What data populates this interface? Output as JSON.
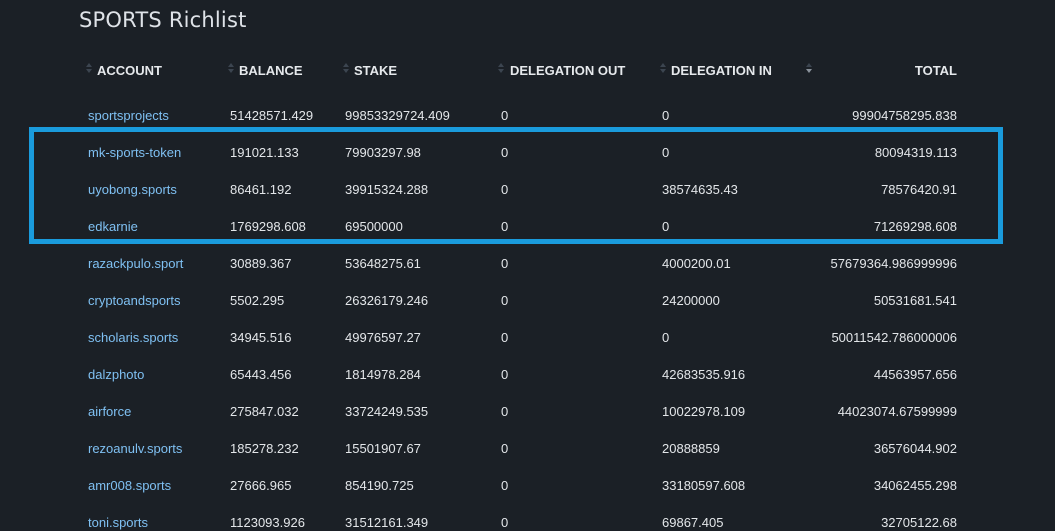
{
  "page_title": "SPORTS Richlist",
  "columns": {
    "account": "ACCOUNT",
    "balance": "BALANCE",
    "stake": "STAKE",
    "delegation_out": "DELEGATION OUT",
    "delegation_in": "DELEGATION IN",
    "total": "TOTAL"
  },
  "rows": [
    {
      "account": "sportsprojects",
      "balance": "51428571.429",
      "stake": "99853329724.409",
      "delegation_out": "0",
      "delegation_in": "0",
      "total": "99904758295.838"
    },
    {
      "account": "mk-sports-token",
      "balance": "191021.133",
      "stake": "79903297.98",
      "delegation_out": "0",
      "delegation_in": "0",
      "total": "80094319.113"
    },
    {
      "account": "uyobong.sports",
      "balance": "86461.192",
      "stake": "39915324.288",
      "delegation_out": "0",
      "delegation_in": "38574635.43",
      "total": "78576420.91"
    },
    {
      "account": "edkarnie",
      "balance": "1769298.608",
      "stake": "69500000",
      "delegation_out": "0",
      "delegation_in": "0",
      "total": "71269298.608"
    },
    {
      "account": "razackpulo.sport",
      "balance": "30889.367",
      "stake": "53648275.61",
      "delegation_out": "0",
      "delegation_in": "4000200.01",
      "total": "57679364.986999996"
    },
    {
      "account": "cryptoandsports",
      "balance": "5502.295",
      "stake": "26326179.246",
      "delegation_out": "0",
      "delegation_in": "24200000",
      "total": "50531681.541"
    },
    {
      "account": "scholaris.sports",
      "balance": "34945.516",
      "stake": "49976597.27",
      "delegation_out": "0",
      "delegation_in": "0",
      "total": "50011542.786000006"
    },
    {
      "account": "dalzphoto",
      "balance": "65443.456",
      "stake": "1814978.284",
      "delegation_out": "0",
      "delegation_in": "42683535.916",
      "total": "44563957.656"
    },
    {
      "account": "airforce",
      "balance": "275847.032",
      "stake": "33724249.535",
      "delegation_out": "0",
      "delegation_in": "10022978.109",
      "total": "44023074.67599999"
    },
    {
      "account": "rezoanulv.sports",
      "balance": "185278.232",
      "stake": "15501907.67",
      "delegation_out": "0",
      "delegation_in": "20888859",
      "total": "36576044.902"
    },
    {
      "account": "amr008.sports",
      "balance": "27666.965",
      "stake": "854190.725",
      "delegation_out": "0",
      "delegation_in": "33180597.608",
      "total": "34062455.298"
    },
    {
      "account": "toni.sports",
      "balance": "1123093.926",
      "stake": "31512161.349",
      "delegation_out": "0",
      "delegation_in": "69867.405",
      "total": "32705122.68"
    }
  ],
  "highlight_color": "#1a9bdc",
  "link_color": "#7fc0f2",
  "sorted_column": "delegation_in",
  "sort_direction": "descending"
}
